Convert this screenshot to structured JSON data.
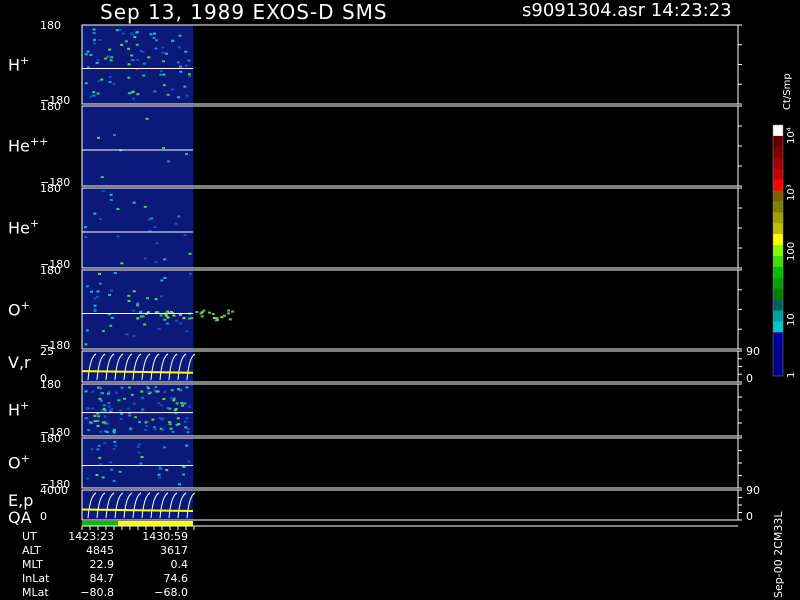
{
  "header": {
    "title": "Sep 13, 1989    EXOS-D SMS",
    "file": "s9091304.asr  14:23:23"
  },
  "chart_data": {
    "type": "heatmap",
    "title": "Sep 13, 1989    EXOS-D SMS",
    "panels": [
      {
        "name": "H+",
        "label_main": "H",
        "label_sup": "+",
        "ylim": [
          -180,
          180
        ],
        "tick_top": "180",
        "tick_bottom": "−180"
      },
      {
        "name": "He++",
        "label_main": "He",
        "label_sup": "++",
        "ylim": [
          -180,
          180
        ],
        "tick_top": "180",
        "tick_bottom": "−180"
      },
      {
        "name": "He+",
        "label_main": "He",
        "label_sup": "+",
        "ylim": [
          -180,
          180
        ],
        "tick_top": "180",
        "tick_bottom": "−180"
      },
      {
        "name": "O+",
        "label_main": "O",
        "label_sup": "+",
        "ylim": [
          -180,
          180
        ],
        "tick_top": "180",
        "tick_bottom": "−180"
      },
      {
        "name": "V,r",
        "label_main": "V,r",
        "label_sup": "",
        "ylim": [
          0,
          25
        ],
        "tick_top": "25",
        "tick_bottom": "0",
        "right_top": "90",
        "right_bottom": "0"
      },
      {
        "name": "H+ (2)",
        "label_main": "H",
        "label_sup": "+",
        "ylim": [
          -180,
          180
        ],
        "tick_top": "180",
        "tick_bottom": "−180"
      },
      {
        "name": "O+ (2)",
        "label_main": "O",
        "label_sup": "+",
        "ylim": [
          -180,
          180
        ],
        "tick_top": "180",
        "tick_bottom": "−180"
      },
      {
        "name": "E,p",
        "label_main": "E,p",
        "label_sup": "",
        "ylim": [
          0,
          4000
        ],
        "tick_top": "4000",
        "tick_bottom": "0",
        "right_top": "90",
        "right_bottom": "0"
      }
    ],
    "qa_label": "QA",
    "colorbar": {
      "label": "Ct/Smp",
      "ticks": [
        "1",
        "10",
        "100",
        "10³",
        "10⁴"
      ],
      "colors": [
        "#000080",
        "#000080",
        "#00008c",
        "#0000a0",
        "#00c8c8",
        "#00a0a0",
        "#006060",
        "#008000",
        "#00a000",
        "#00c000",
        "#40e000",
        "#80ff00",
        "#ffff00",
        "#c0c000",
        "#a0a000",
        "#808000",
        "#806000",
        "#ff0000",
        "#c00000",
        "#a00000",
        "#800000",
        "#600000",
        "#ffffff"
      ]
    },
    "time_info": {
      "rows": [
        {
          "label": "UT",
          "start": "1423:23",
          "end": "1430:59"
        },
        {
          "label": "ALT",
          "start": "4845",
          "end": "3617"
        },
        {
          "label": "MLT",
          "start": "22.9",
          "end": "0.4"
        },
        {
          "label": "InLat",
          "start": "84.7",
          "end": "74.6"
        },
        {
          "label": "MLat",
          "start": "−80.8",
          "end": "−68.0"
        }
      ]
    },
    "version": "Sep-00 2CM33L"
  },
  "colors": {
    "background": "#000000",
    "data_fill": "#0b1a78",
    "axis": "#ffffff",
    "trace": "#ffff00",
    "qa_good": "#00c000",
    "qa_flag": "#ffff00"
  }
}
